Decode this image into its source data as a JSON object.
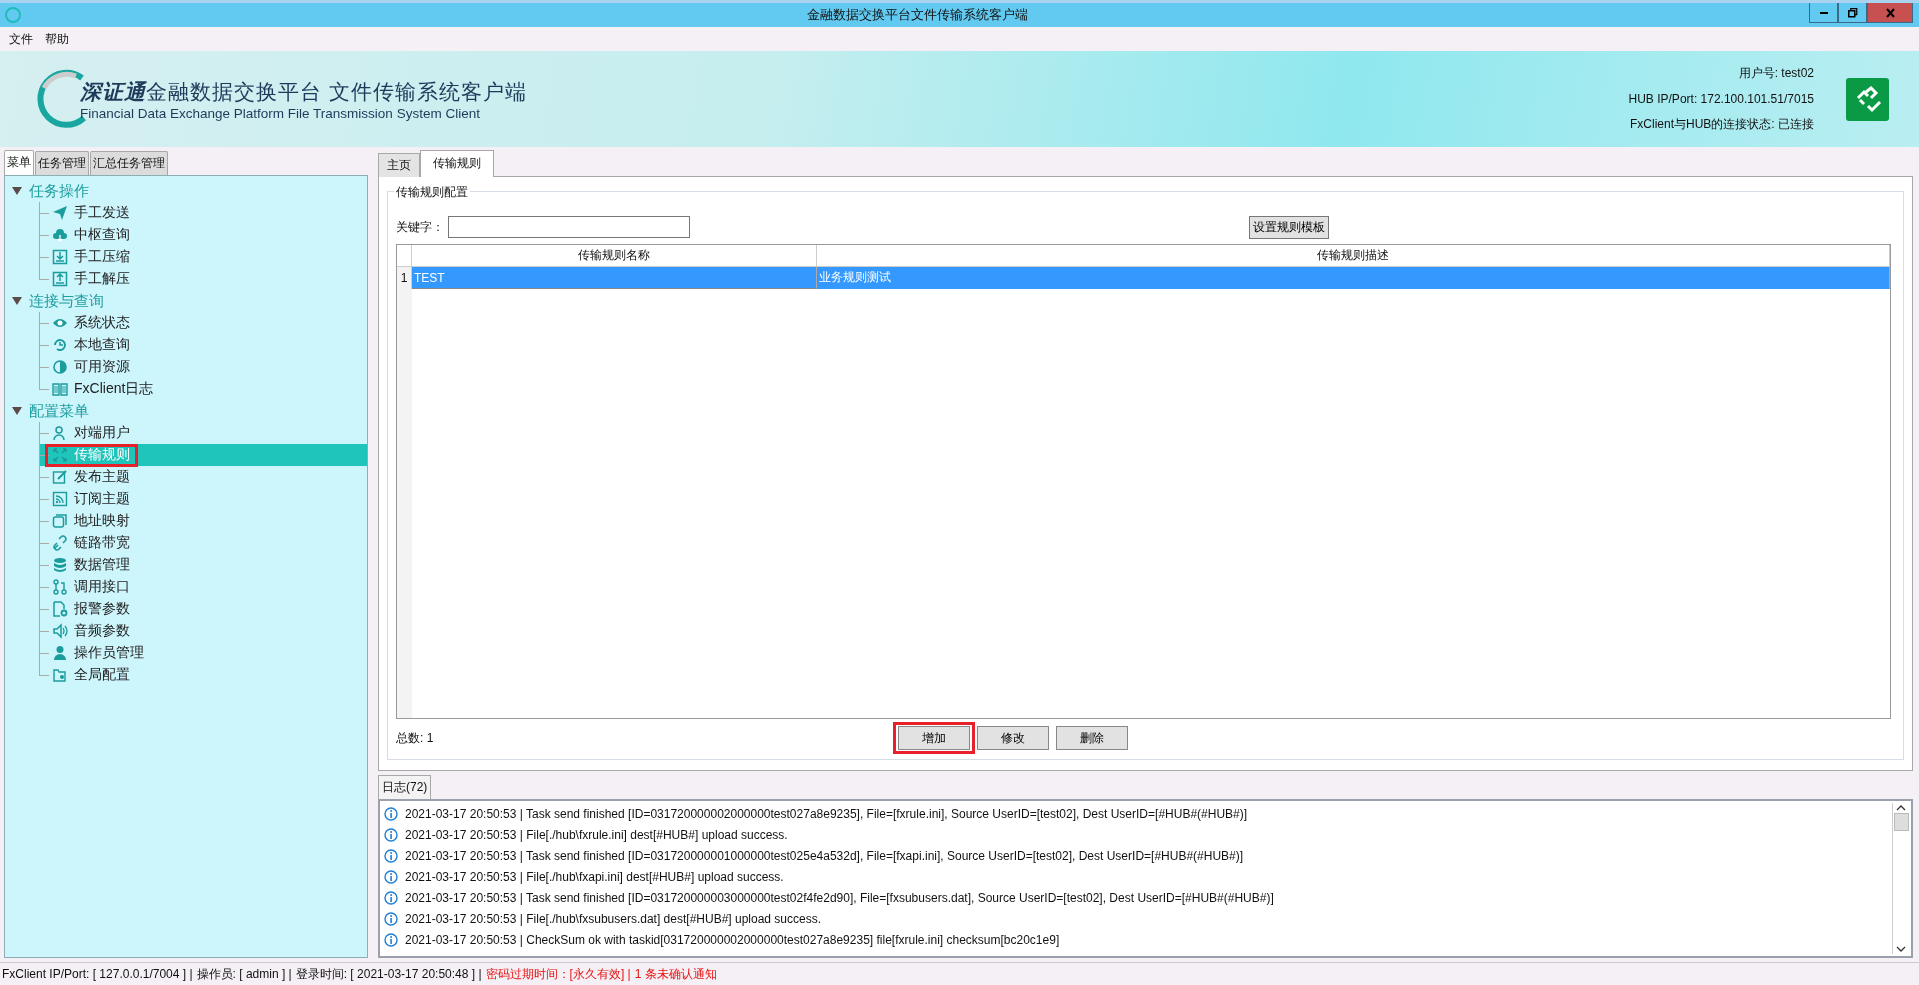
{
  "window": {
    "title": "金融数据交换平台文件传输系统客户端"
  },
  "menu_bar": [
    {
      "label": "文件"
    },
    {
      "label": "帮助"
    }
  ],
  "banner": {
    "brand": "深证通",
    "title": "金融数据交换平台  文件传输系统客户端",
    "subtitle": "Financial Data Exchange Platform File Transmission System Client",
    "info": [
      "用户号: test02",
      "HUB IP/Port: 172.100.101.51/7015",
      "FxClient与HUB的连接状态: 已连接"
    ],
    "connected": true
  },
  "sidebar": {
    "tabs": [
      {
        "label": "菜单",
        "selected": true
      },
      {
        "label": "任务管理",
        "selected": false
      },
      {
        "label": "汇总任务管理",
        "selected": false
      }
    ],
    "tree": [
      {
        "label": "任务操作",
        "expanded": true,
        "children": [
          {
            "label": "手工发送",
            "selected": false,
            "highlighted": false
          },
          {
            "label": "中枢查询",
            "selected": false,
            "highlighted": false
          },
          {
            "label": "手工压缩",
            "selected": false,
            "highlighted": false
          },
          {
            "label": "手工解压",
            "selected": false,
            "highlighted": false
          }
        ]
      },
      {
        "label": "连接与查询",
        "expanded": true,
        "children": [
          {
            "label": "系统状态",
            "selected": false,
            "highlighted": false
          },
          {
            "label": "本地查询",
            "selected": false,
            "highlighted": false
          },
          {
            "label": "可用资源",
            "selected": false,
            "highlighted": false
          },
          {
            "label": "FxClient日志",
            "selected": false,
            "highlighted": false
          }
        ]
      },
      {
        "label": "配置菜单",
        "expanded": true,
        "children": [
          {
            "label": "对端用户",
            "selected": false,
            "highlighted": false
          },
          {
            "label": "传输规则",
            "selected": true,
            "highlighted": true
          },
          {
            "label": "发布主题",
            "selected": false,
            "highlighted": false
          },
          {
            "label": "订阅主题",
            "selected": false,
            "highlighted": false
          },
          {
            "label": "地址映射",
            "selected": false,
            "highlighted": false
          },
          {
            "label": "链路带宽",
            "selected": false,
            "highlighted": false
          },
          {
            "label": "数据管理",
            "selected": false,
            "highlighted": false
          },
          {
            "label": "调用接口",
            "selected": false,
            "highlighted": false
          },
          {
            "label": "报警参数",
            "selected": false,
            "highlighted": false
          },
          {
            "label": "音频参数",
            "selected": false,
            "highlighted": false
          },
          {
            "label": "操作员管理",
            "selected": false,
            "highlighted": false
          },
          {
            "label": "全局配置",
            "selected": false,
            "highlighted": false
          }
        ]
      }
    ]
  },
  "main": {
    "tabs": [
      {
        "label": "主页",
        "selected": false
      },
      {
        "label": "传输规则",
        "selected": true
      }
    ],
    "group_title": "传输规则配置",
    "keyword_label": "关键字：",
    "template_button": "设置规则模板",
    "table": {
      "columns": [
        "传输规则名称",
        "传输规则描述"
      ],
      "rows": [
        {
          "number": "1",
          "cells": [
            "TEST",
            "业务规则测试"
          ],
          "selected": true
        }
      ]
    },
    "total": "总数: 1",
    "buttons": [
      {
        "label": "增加",
        "highlighted": true
      },
      {
        "label": "修改",
        "highlighted": false
      },
      {
        "label": "删除",
        "highlighted": false
      }
    ]
  },
  "log": {
    "tab": "日志(72)",
    "entries": [
      "2021-03-17 20:50:53  |  Task send finished [ID=031720000002000000test027a8e9235], File=[fxrule.ini], Source UserID=[test02], Dest UserID=[#HUB#(#HUB#)]",
      "2021-03-17 20:50:53  |  File[./hub\\fxrule.ini] dest[#HUB#] upload success.",
      "2021-03-17 20:50:53  |  Task send finished [ID=031720000001000000test025e4a532d], File=[fxapi.ini], Source UserID=[test02], Dest UserID=[#HUB#(#HUB#)]",
      "2021-03-17 20:50:53  |  File[./hub\\fxapi.ini] dest[#HUB#] upload success.",
      "2021-03-17 20:50:53  |  Task send finished [ID=031720000003000000test02f4fe2d90], File=[fxsubusers.dat], Source UserID=[test02], Dest UserID=[#HUB#(#HUB#)]",
      "2021-03-17 20:50:53  |  File[./hub\\fxsubusers.dat] dest[#HUB#] upload success.",
      "2021-03-17 20:50:53  |  CheckSum ok with taskid[031720000002000000test027a8e9235] file[fxrule.ini] checksum[bc20c1e9]"
    ]
  },
  "status_bar": [
    {
      "text": "FxClient IP/Port: [ 127.0.0.1/7004 ] |",
      "warning": false
    },
    {
      "text": "操作员: [ admin ] |",
      "warning": false
    },
    {
      "text": "登录时间: [ 2021-03-17 20:50:48 ] |",
      "warning": false
    },
    {
      "text": "密码过期时间：[永久有效] |",
      "warning": true
    },
    {
      "text": "1 条未确认通知",
      "warning": true
    }
  ]
}
